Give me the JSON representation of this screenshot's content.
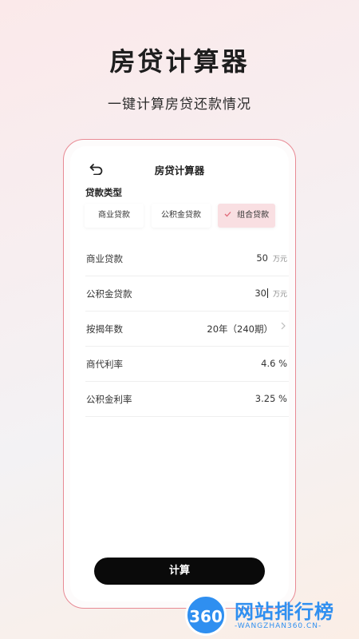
{
  "hero": {
    "title": "房贷计算器",
    "subtitle": "一键计算房贷还款情况"
  },
  "app": {
    "title": "房贷计算器",
    "loan_type_label": "贷款类型",
    "loan_types": [
      "商业贷款",
      "公积金贷款",
      "组合贷款"
    ],
    "selected_type": "组合贷款",
    "rows": {
      "commercial": {
        "label": "商业贷款",
        "value": "50",
        "unit": "万元"
      },
      "fund": {
        "label": "公积金贷款",
        "value": "30",
        "unit": "万元"
      },
      "years": {
        "label": "按揭年数",
        "value": "20年（240期）"
      },
      "commercial_rate": {
        "label": "商代利率",
        "value": "4.6 %"
      },
      "fund_rate": {
        "label": "公积金利率",
        "value": "3.25 %"
      }
    },
    "calculate_label": "计算"
  },
  "watermark": {
    "logo": "360",
    "name": "网站排行榜",
    "url": "-WANGZHAN360.CN-"
  },
  "colors": {
    "accent": "#e06b7a",
    "selected_bg": "#f9dfe2",
    "button": "#0a0a0a",
    "border": "#e88a94",
    "watermark": "#2f8ff0"
  }
}
